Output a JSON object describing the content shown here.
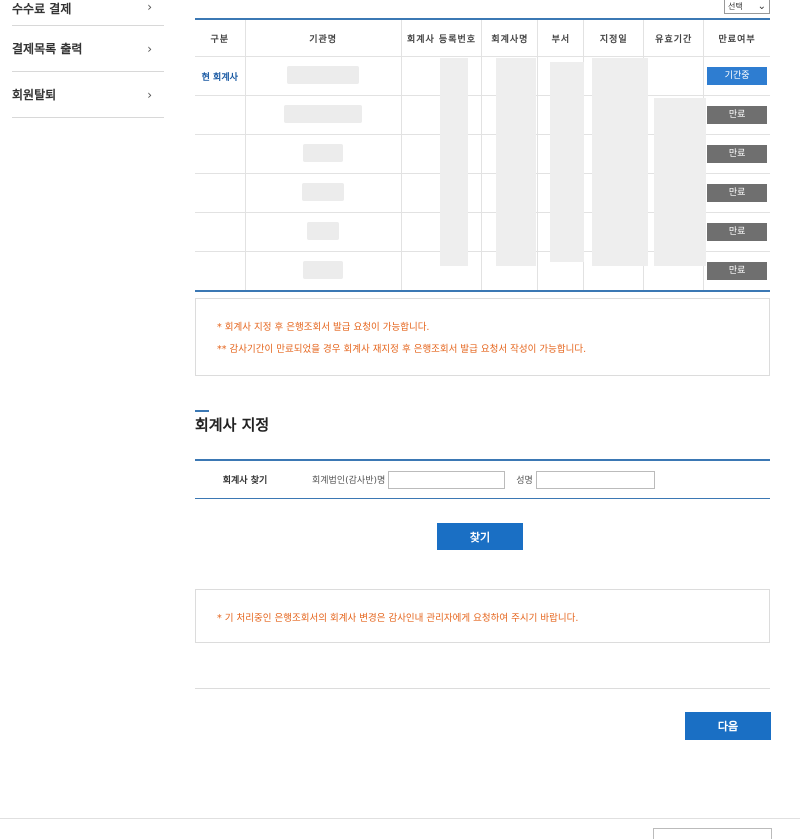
{
  "sidebar": {
    "items": [
      {
        "label": "수수료 결제"
      },
      {
        "label": "결제목록 출력"
      },
      {
        "label": "회원탈퇴"
      }
    ]
  },
  "top_select": {
    "value": "선택"
  },
  "table": {
    "headers": [
      "구분",
      "기관명",
      "회계사 등록번호",
      "회계사명",
      "부서",
      "지정일",
      "유효기간",
      "만료여부"
    ],
    "rows": [
      {
        "type": "현 회계사",
        "status": "기간중"
      },
      {
        "type": "",
        "status": "만료"
      },
      {
        "type": "",
        "status": "만료"
      },
      {
        "type": "",
        "status": "만료"
      },
      {
        "type": "",
        "status": "만료"
      },
      {
        "type": "",
        "status": "만료"
      }
    ]
  },
  "notice1": {
    "lines": [
      "* 회계사 지정 후 은행조회서 발급 요청이 가능합니다.",
      "** 감사기간이 만료되었을 경우 회계사 재지정 후 은행조회서 발급 요청서 작성이 가능합니다."
    ]
  },
  "section": {
    "title": "회계사 지정"
  },
  "search": {
    "label": "회계사 찾기",
    "firm_label": "회계법인(감사반)명",
    "firm_value": "",
    "name_label": "성명",
    "name_value": "",
    "button": "찾기"
  },
  "notice2": {
    "text": "* 기 처리중인 은행조회서의 회계사 변경은 감사인내 관리자에게 요청하여 주시기 바랍니다."
  },
  "next_button": "다음",
  "colors": {
    "accent": "#1a6fc4",
    "table_border": "#3b78b4",
    "notice_text": "#e5651d",
    "expired": "#6f6f6f"
  }
}
